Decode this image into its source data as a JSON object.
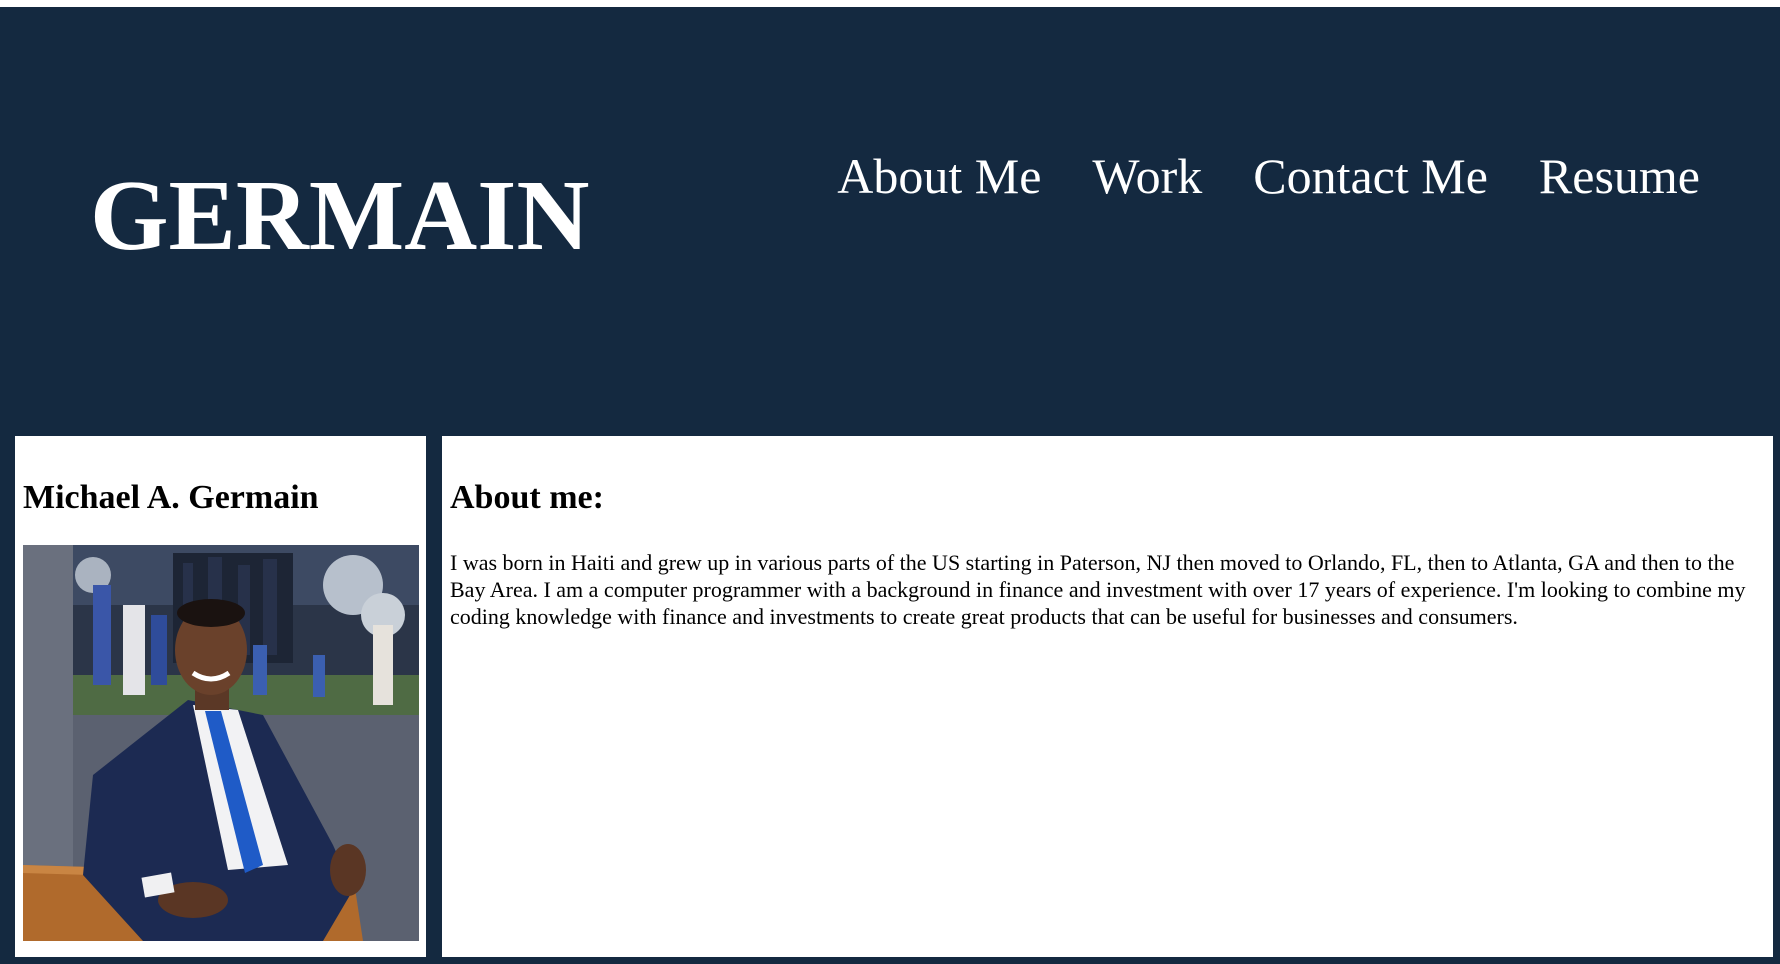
{
  "header": {
    "brand": "GERMAIN",
    "nav": [
      {
        "label": "About Me"
      },
      {
        "label": "Work"
      },
      {
        "label": "Contact Me"
      },
      {
        "label": "Resume"
      }
    ]
  },
  "profile": {
    "name": "Michael A. Germain",
    "photo_icon": "portrait-photo"
  },
  "about": {
    "heading": "About me:",
    "body": "I was born in Haiti and grew up in various parts of the US starting in Paterson, NJ then moved to Orlando, FL, then to Atlanta, GA and then to the Bay Area. I am a computer programmer with a background in finance and investment with over 17 years of experience. I'm looking to combine my coding knowledge with finance and investments to create great products that can be useful for businesses and consumers."
  },
  "colors": {
    "header_bg": "#142940",
    "card_bg": "#ffffff",
    "text": "#000000",
    "nav_text": "#ffffff"
  }
}
